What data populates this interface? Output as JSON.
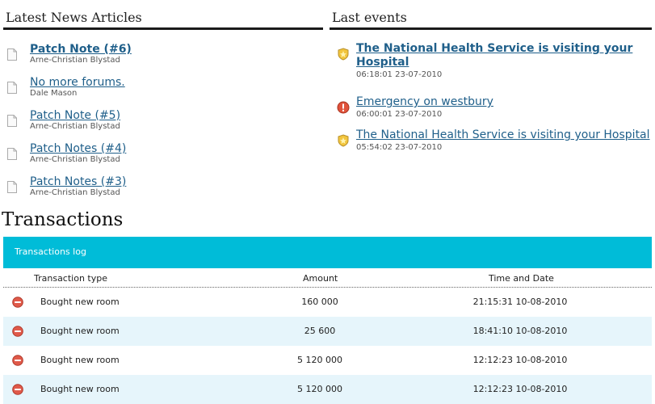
{
  "news": {
    "heading": "Latest News Articles",
    "items": [
      {
        "title": "Patch Note (#6)",
        "author": "Arne-Christian Blystad"
      },
      {
        "title": "No more forums.",
        "author": "Dale Mason"
      },
      {
        "title": "Patch Note (#5)",
        "author": "Arne-Christian Blystad"
      },
      {
        "title": "Patch Notes (#4)",
        "author": "Arne-Christian Blystad"
      },
      {
        "title": "Patch Notes (#3)",
        "author": "Arne-Christian Blystad"
      }
    ]
  },
  "events": {
    "heading": "Last events",
    "items": [
      {
        "title": "The National Health Service is visiting your Hospital",
        "time": "06:18:01 23-07-2010",
        "icon": "shield-icon"
      },
      {
        "title": "Emergency on westbury",
        "time": "06:00:01 23-07-2010",
        "icon": "alert-icon"
      },
      {
        "title": "The National Health Service is visiting your Hospital",
        "time": "05:54:02 23-07-2010",
        "icon": "shield-icon"
      }
    ]
  },
  "transactions": {
    "title": "Transactions",
    "log_title": "Transactions log",
    "columns": {
      "type": "Transaction type",
      "amount": "Amount",
      "time": "Time and Date"
    },
    "rows": [
      {
        "type": "Bought new room",
        "amount": "160 000",
        "time": "21:15:31 10-08-2010"
      },
      {
        "type": "Bought new room",
        "amount": "25 600",
        "time": "18:41:10 10-08-2010"
      },
      {
        "type": "Bought new room",
        "amount": "5 120 000",
        "time": "12:12:23 10-08-2010"
      },
      {
        "type": "Bought new room",
        "amount": "5 120 000",
        "time": "12:12:23 10-08-2010"
      }
    ]
  },
  "colors": {
    "link": "#1f5f8a",
    "accent": "#00bcd8",
    "row_alt": "#e6f5fb",
    "minus": "#e05a4a"
  }
}
